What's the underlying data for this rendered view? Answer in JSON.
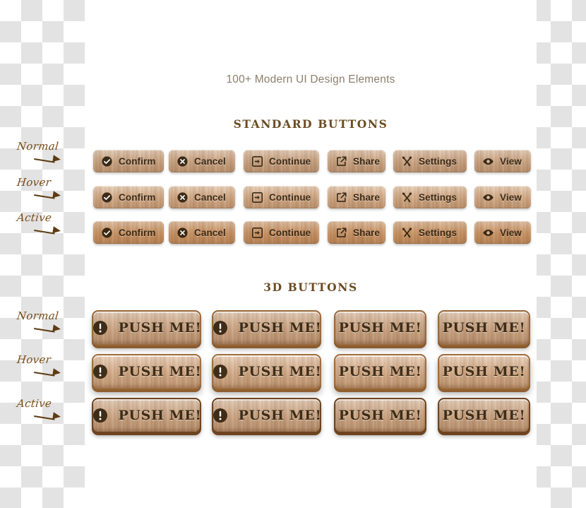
{
  "page": {
    "title": "100+ Modern UI Design Elements",
    "background": "transparent-checkerboard",
    "colors": {
      "heading_brown": "#6b4b22",
      "title_gray_brown": "#8c7f6d",
      "label_brown": "#7a4d18",
      "wood_base": "#cba583",
      "wood_active": "#c79a72",
      "text_dark": "#3a2a18"
    }
  },
  "sections": [
    {
      "id": "standard-buttons",
      "heading": "STANDARD BUTTONS",
      "state_labels": [
        "Normal",
        "Hover",
        "Active"
      ],
      "buttons": [
        {
          "label": "Confirm",
          "icon": "check-circle-icon"
        },
        {
          "label": "Cancel",
          "icon": "close-circle-icon"
        },
        {
          "label": "Continue",
          "icon": "arrow-right-box-icon"
        },
        {
          "label": "Share",
          "icon": "external-link-icon"
        },
        {
          "label": "Settings",
          "icon": "tools-cross-icon"
        },
        {
          "label": "View",
          "icon": "eye-icon"
        }
      ]
    },
    {
      "id": "3d-buttons",
      "heading": "3D BUTTONS",
      "state_labels": [
        "Normal",
        "Hover",
        "Active"
      ],
      "buttons": [
        {
          "label": "PUSH ME!",
          "icon": "exclamation-circle-icon"
        },
        {
          "label": "PUSH ME!",
          "icon": "exclamation-circle-icon"
        },
        {
          "label": "PUSH ME!",
          "icon": "none"
        },
        {
          "label": "PUSH ME!",
          "icon": "none"
        }
      ]
    }
  ]
}
